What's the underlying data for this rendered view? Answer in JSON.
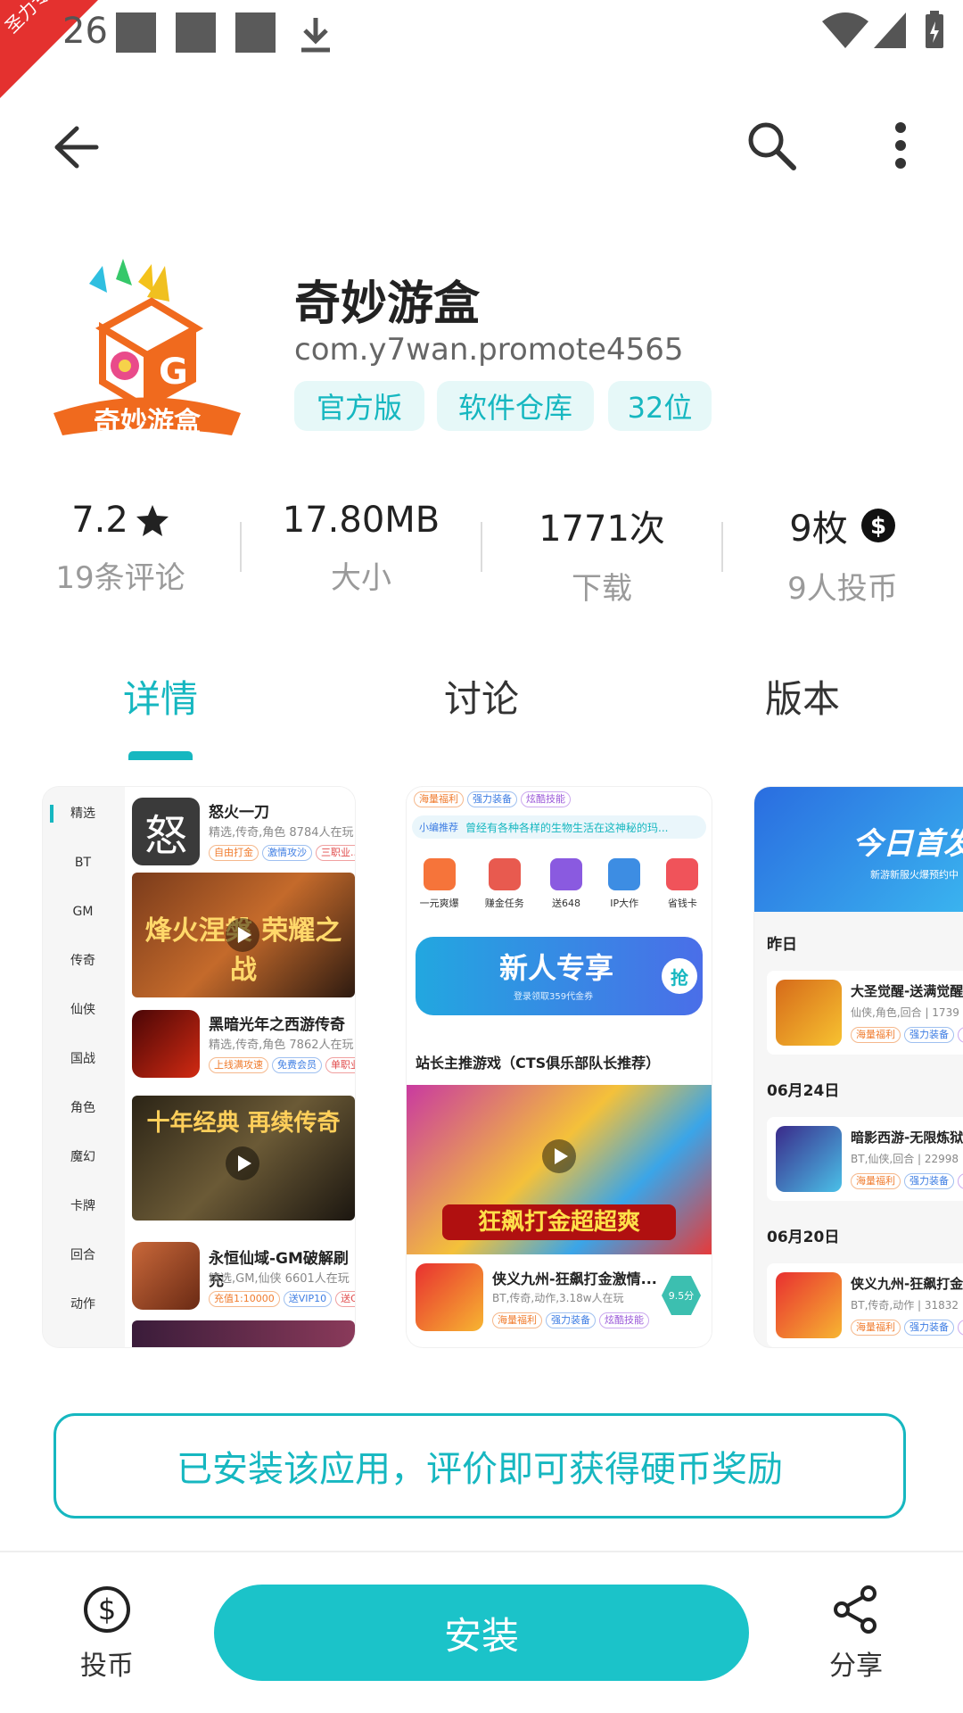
{
  "status_bar": {
    "time": "26",
    "ribbon_text": "圣力专测"
  },
  "app": {
    "name": "奇妙游盒",
    "package": "com.y7wan.promote4565",
    "logo_text": "奇妙游盒",
    "tags": [
      "官方版",
      "软件仓库",
      "32位"
    ]
  },
  "stats": [
    {
      "value": "7.2",
      "label": "19条评论"
    },
    {
      "value": "17.80MB",
      "label": "大小"
    },
    {
      "value": "1771次",
      "label": "下载"
    },
    {
      "value": "9枚",
      "label": "9人投币"
    }
  ],
  "tabs": [
    "详情",
    "讨论",
    "版本"
  ],
  "active_tab": "详情",
  "screenshot1": {
    "categories": [
      "精选",
      "BT",
      "GM",
      "传奇",
      "仙侠",
      "国战",
      "角色",
      "魔幻",
      "卡牌",
      "回合",
      "动作"
    ],
    "games": [
      {
        "title": "怒火一刀",
        "meta": "精选,传奇,角色 8784人在玩",
        "chips": [
          "自由打金",
          "激情攻沙",
          "三职业..."
        ],
        "banner": "烽火涅槃 荣耀之战"
      },
      {
        "title": "黑暗光年之西游传奇",
        "meta": "精选,传奇,角色 7862人在玩",
        "chips": [
          "上线满攻速",
          "免费会员",
          "单职业"
        ],
        "banner": "十年经典 再续传奇"
      },
      {
        "title": "永恒仙域-GM破解刷充",
        "meta": "精选,GM,仙侠 6601人在玩",
        "chips": [
          "充值1:10000",
          "送VIP10",
          "送G..."
        ]
      }
    ]
  },
  "screenshot2": {
    "top_chips": [
      "海量福利",
      "强力装备",
      "炫酷技能"
    ],
    "notice": "曾经有各种各样的生物生活在这神秘的玛...",
    "notice_label": "小编推荐",
    "shortcuts": [
      "一元爽爆",
      "赚金任务",
      "送648",
      "IP大作",
      "省钱卡"
    ],
    "banner_title": "新人专享",
    "banner_sub": "登录领取359代金券",
    "banner_btn": "抢",
    "section_title": "站长主推游戏（CTS俱乐部队长推荐）",
    "feature_text": "狂飙打金超超爽",
    "game": {
      "title": "侠义九州-狂飙打金激情...",
      "meta": "BT,传奇,动作,3.18w人在玩",
      "score": "9.5分",
      "chips": [
        "海量福利",
        "强力装备",
        "炫酷技能"
      ]
    }
  },
  "screenshot3": {
    "banner_title": "今日首发",
    "banner_sub": "新游新服火爆预约中",
    "sections": [
      {
        "date": "昨日",
        "title": "大圣觉醒-送满觉醒",
        "meta": "仙侠,角色,回合 | 1739"
      },
      {
        "date": "06月24日",
        "title": "暗影西游-无限炼狱",
        "meta": "BT,仙侠,回合 | 22998"
      },
      {
        "date": "06月20日",
        "title": "侠义九州-狂飙打金",
        "meta": "BT,传奇,动作 | 31832"
      }
    ],
    "chips": [
      "海量福利",
      "强力装备",
      "炫"
    ]
  },
  "reward_notice": "已安装该应用，评价即可获得硬币奖励",
  "bottom": {
    "coin_label": "投币",
    "install_label": "安装",
    "share_label": "分享"
  },
  "colors": {
    "accent": "#16b7c0",
    "install_bg": "#1bc3c9",
    "ribbon": "#e4312f"
  }
}
